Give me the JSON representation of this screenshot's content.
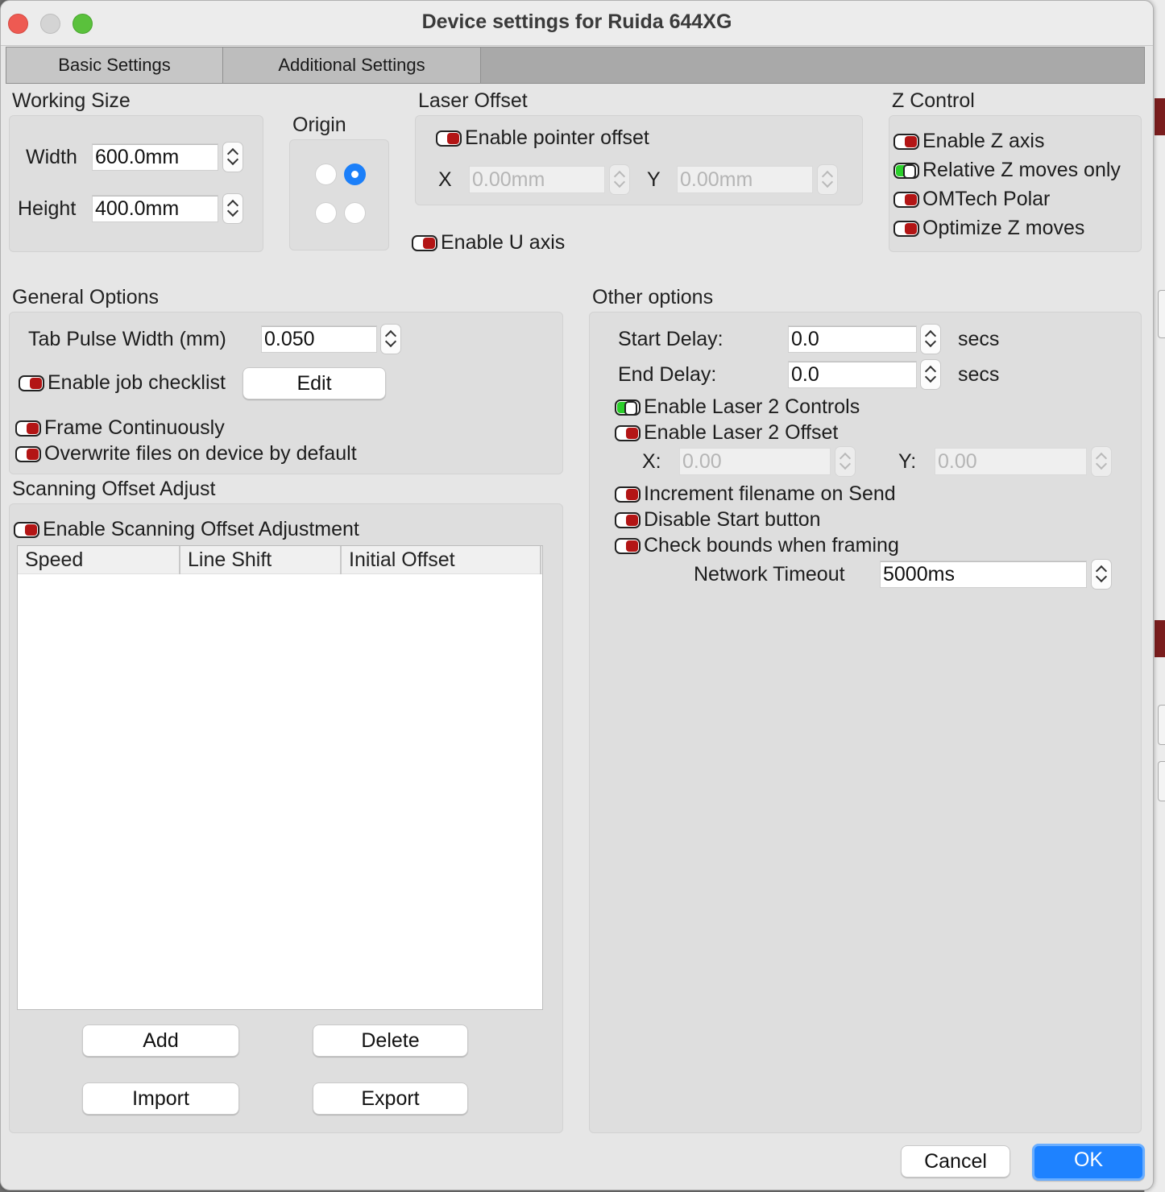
{
  "window": {
    "title": "Device settings for Ruida 644XG"
  },
  "tabs": [
    {
      "label": "Basic Settings",
      "active": true
    },
    {
      "label": "Additional Settings",
      "active": false
    }
  ],
  "working_size": {
    "title": "Working Size",
    "width_label": "Width",
    "width_value": "600.0mm",
    "height_label": "Height",
    "height_value": "400.0mm"
  },
  "origin": {
    "title": "Origin",
    "selected": "top-right"
  },
  "laser_offset": {
    "title": "Laser Offset",
    "enable_pointer_offset": {
      "label": "Enable pointer offset",
      "on": false
    },
    "x_label": "X",
    "x_value": "0.00mm",
    "y_label": "Y",
    "y_value": "0.00mm",
    "enable_u_axis": {
      "label": "Enable U axis",
      "on": false
    }
  },
  "z_control": {
    "title": "Z Control",
    "options": [
      {
        "label": "Enable Z axis",
        "on": false
      },
      {
        "label": "Relative Z moves only",
        "on": true
      },
      {
        "label": "OMTech Polar",
        "on": false
      },
      {
        "label": "Optimize Z moves",
        "on": false
      }
    ]
  },
  "general_options": {
    "title": "General Options",
    "tab_pulse_label": "Tab Pulse Width (mm)",
    "tab_pulse_value": "0.050",
    "job_checklist": {
      "label": "Enable job checklist",
      "on": false
    },
    "edit_button": "Edit",
    "frame_continuously": {
      "label": "Frame Continuously",
      "on": false
    },
    "overwrite_files": {
      "label": "Overwrite files on device by default",
      "on": false
    }
  },
  "scanning_offset": {
    "title": "Scanning Offset Adjust",
    "enable": {
      "label": "Enable Scanning Offset Adjustment",
      "on": false
    },
    "columns": [
      "Speed",
      "Line Shift",
      "Initial Offset"
    ],
    "rows": [],
    "buttons": {
      "add": "Add",
      "delete": "Delete",
      "import": "Import",
      "export": "Export"
    }
  },
  "other_options": {
    "title": "Other options",
    "start_delay_label": "Start Delay:",
    "start_delay_value": "0.0",
    "start_delay_unit": "secs",
    "end_delay_label": "End Delay:",
    "end_delay_value": "0.0",
    "end_delay_unit": "secs",
    "laser2_controls": {
      "label": "Enable Laser 2 Controls",
      "on": true
    },
    "laser2_offset": {
      "label": "Enable Laser 2 Offset",
      "on": false
    },
    "laser2_x_label": "X:",
    "laser2_x_value": "0.00",
    "laser2_y_label": "Y:",
    "laser2_y_value": "0.00",
    "increment_filename": {
      "label": "Increment filename on Send",
      "on": false
    },
    "disable_start": {
      "label": "Disable Start button",
      "on": false
    },
    "check_bounds": {
      "label": "Check bounds when framing",
      "on": false
    },
    "network_timeout_label": "Network Timeout",
    "network_timeout_value": "5000ms"
  },
  "footer": {
    "cancel": "Cancel",
    "ok": "OK"
  },
  "colors": {
    "toggle_off": "#b31515",
    "toggle_on": "#2bcf2b",
    "primary": "#1e82ff"
  }
}
